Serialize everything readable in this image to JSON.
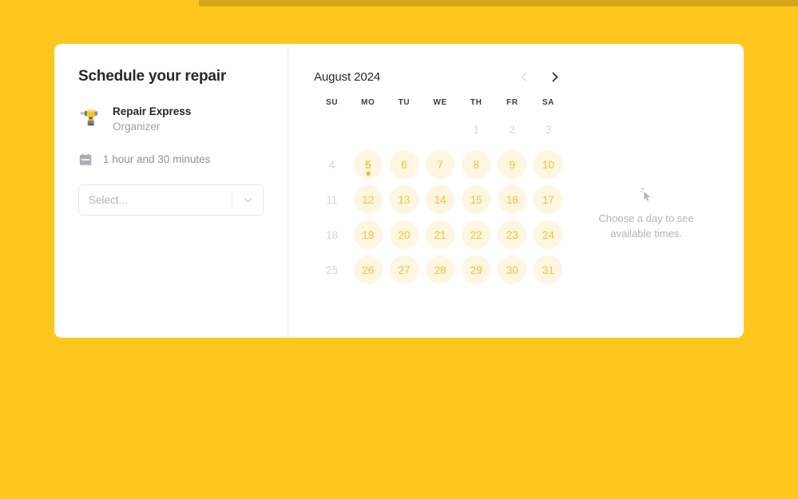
{
  "theme": {
    "page_background": "#ffc61e",
    "top_strip": "#d9a71b",
    "card_background": "#ffffff",
    "accent": "#fbc02d",
    "day_pill_background": "#fdf6e1",
    "muted_text": "#b0b4b9"
  },
  "event": {
    "title": "Schedule your repair",
    "organizer_icon": "drill-icon",
    "organizer_name": "Repair Express",
    "organizer_role": "Organizer",
    "duration_icon": "calendar-icon",
    "duration": "1 hour and 30 minutes",
    "select": {
      "placeholder": "Select...",
      "value": "Select...",
      "arrow_icon": "chevron-down-icon"
    }
  },
  "calendar": {
    "month_label": "August 2024",
    "prev_icon": "chevron-left-icon",
    "next_icon": "chevron-right-icon",
    "prev_enabled": false,
    "next_enabled": true,
    "weekdays": [
      "SU",
      "MO",
      "TU",
      "WE",
      "TH",
      "FR",
      "SA"
    ],
    "weeks": [
      [
        {
          "label": "",
          "state": "empty"
        },
        {
          "label": "",
          "state": "empty"
        },
        {
          "label": "",
          "state": "empty"
        },
        {
          "label": "",
          "state": "empty"
        },
        {
          "label": "1",
          "state": "disabled"
        },
        {
          "label": "2",
          "state": "disabled"
        },
        {
          "label": "3",
          "state": "disabled"
        }
      ],
      [
        {
          "label": "4",
          "state": "disabled"
        },
        {
          "label": "5",
          "state": "available",
          "today": true
        },
        {
          "label": "6",
          "state": "available"
        },
        {
          "label": "7",
          "state": "available"
        },
        {
          "label": "8",
          "state": "available"
        },
        {
          "label": "9",
          "state": "available"
        },
        {
          "label": "10",
          "state": "available"
        }
      ],
      [
        {
          "label": "11",
          "state": "disabled"
        },
        {
          "label": "12",
          "state": "available"
        },
        {
          "label": "13",
          "state": "available"
        },
        {
          "label": "14",
          "state": "available"
        },
        {
          "label": "15",
          "state": "available"
        },
        {
          "label": "16",
          "state": "available"
        },
        {
          "label": "17",
          "state": "available"
        }
      ],
      [
        {
          "label": "18",
          "state": "disabled"
        },
        {
          "label": "19",
          "state": "available"
        },
        {
          "label": "20",
          "state": "available"
        },
        {
          "label": "21",
          "state": "available"
        },
        {
          "label": "22",
          "state": "available"
        },
        {
          "label": "23",
          "state": "available"
        },
        {
          "label": "24",
          "state": "available"
        }
      ],
      [
        {
          "label": "25",
          "state": "disabled"
        },
        {
          "label": "26",
          "state": "available"
        },
        {
          "label": "27",
          "state": "available"
        },
        {
          "label": "28",
          "state": "available"
        },
        {
          "label": "29",
          "state": "available"
        },
        {
          "label": "30",
          "state": "available"
        },
        {
          "label": "31",
          "state": "available"
        }
      ]
    ]
  },
  "slots_panel": {
    "icon": "cursor-click-icon",
    "empty_message": "Choose a day to see available times."
  }
}
